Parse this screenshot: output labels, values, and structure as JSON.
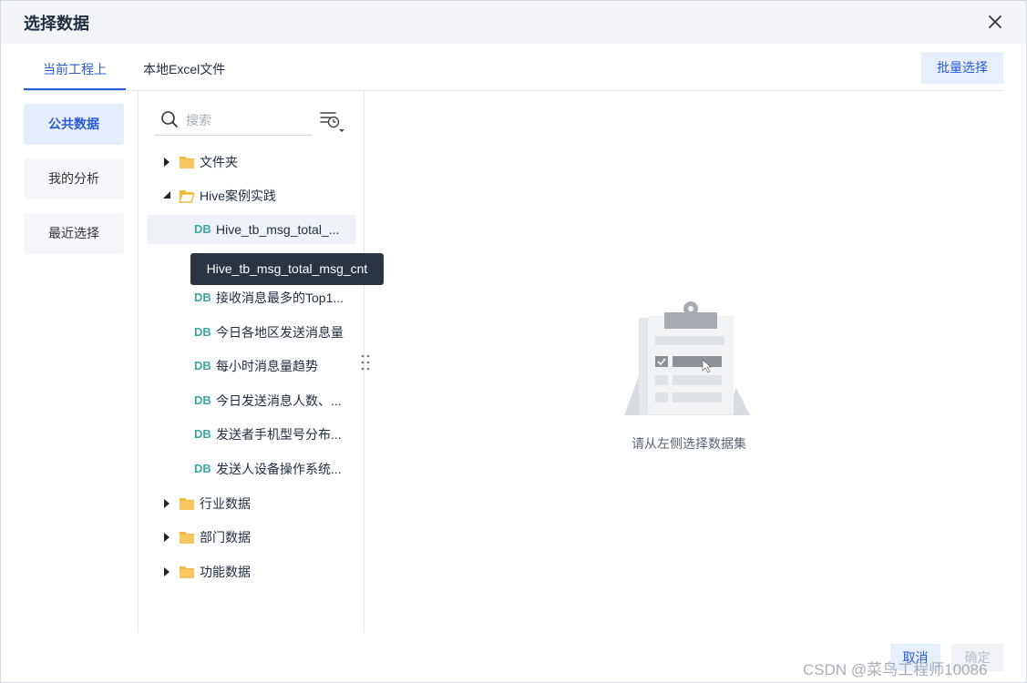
{
  "dialog": {
    "title": "选择数据"
  },
  "tabs": [
    {
      "label": "当前工程上",
      "active": true
    },
    {
      "label": "本地Excel文件",
      "active": false
    }
  ],
  "batch_select_label": "批量选择",
  "left_nav": [
    {
      "label": "公共数据",
      "active": true
    },
    {
      "label": "我的分析",
      "active": false
    },
    {
      "label": "最近选择",
      "active": false
    }
  ],
  "search": {
    "placeholder": "搜索",
    "value": ""
  },
  "tree": {
    "folders_top": [
      {
        "label": "文件夹",
        "expanded": false
      }
    ],
    "open_folder": {
      "label": "Hive案例实践",
      "expanded": true,
      "datasets": [
        {
          "tag": "DB",
          "label": "Hive_tb_msg_total_...",
          "selected": true
        },
        {
          "tag": "DB",
          "label": "接收消息最多的Top1..."
        },
        {
          "tag": "DB",
          "label": "今日各地区发送消息量"
        },
        {
          "tag": "DB",
          "label": "每小时消息量趋势"
        },
        {
          "tag": "DB",
          "label": "今日发送消息人数、..."
        },
        {
          "tag": "DB",
          "label": "发送者手机型号分布..."
        },
        {
          "tag": "DB",
          "label": "发送人设备操作系统..."
        }
      ]
    },
    "folders_bottom": [
      {
        "label": "行业数据",
        "expanded": false
      },
      {
        "label": "部门数据",
        "expanded": false
      },
      {
        "label": "功能数据",
        "expanded": false
      }
    ]
  },
  "tooltip": "Hive_tb_msg_total_msg_cnt",
  "empty_state": {
    "text": "请从左侧选择数据集"
  },
  "footer": {
    "cancel_label": "取消",
    "ok_label": "确定"
  },
  "watermark": "CSDN @菜鸟工程师10086",
  "colors": {
    "accent": "#2a5bd7",
    "db_tag": "#3aa8a2",
    "folder": "#f5b83d",
    "tooltip_bg": "#2b3441"
  }
}
